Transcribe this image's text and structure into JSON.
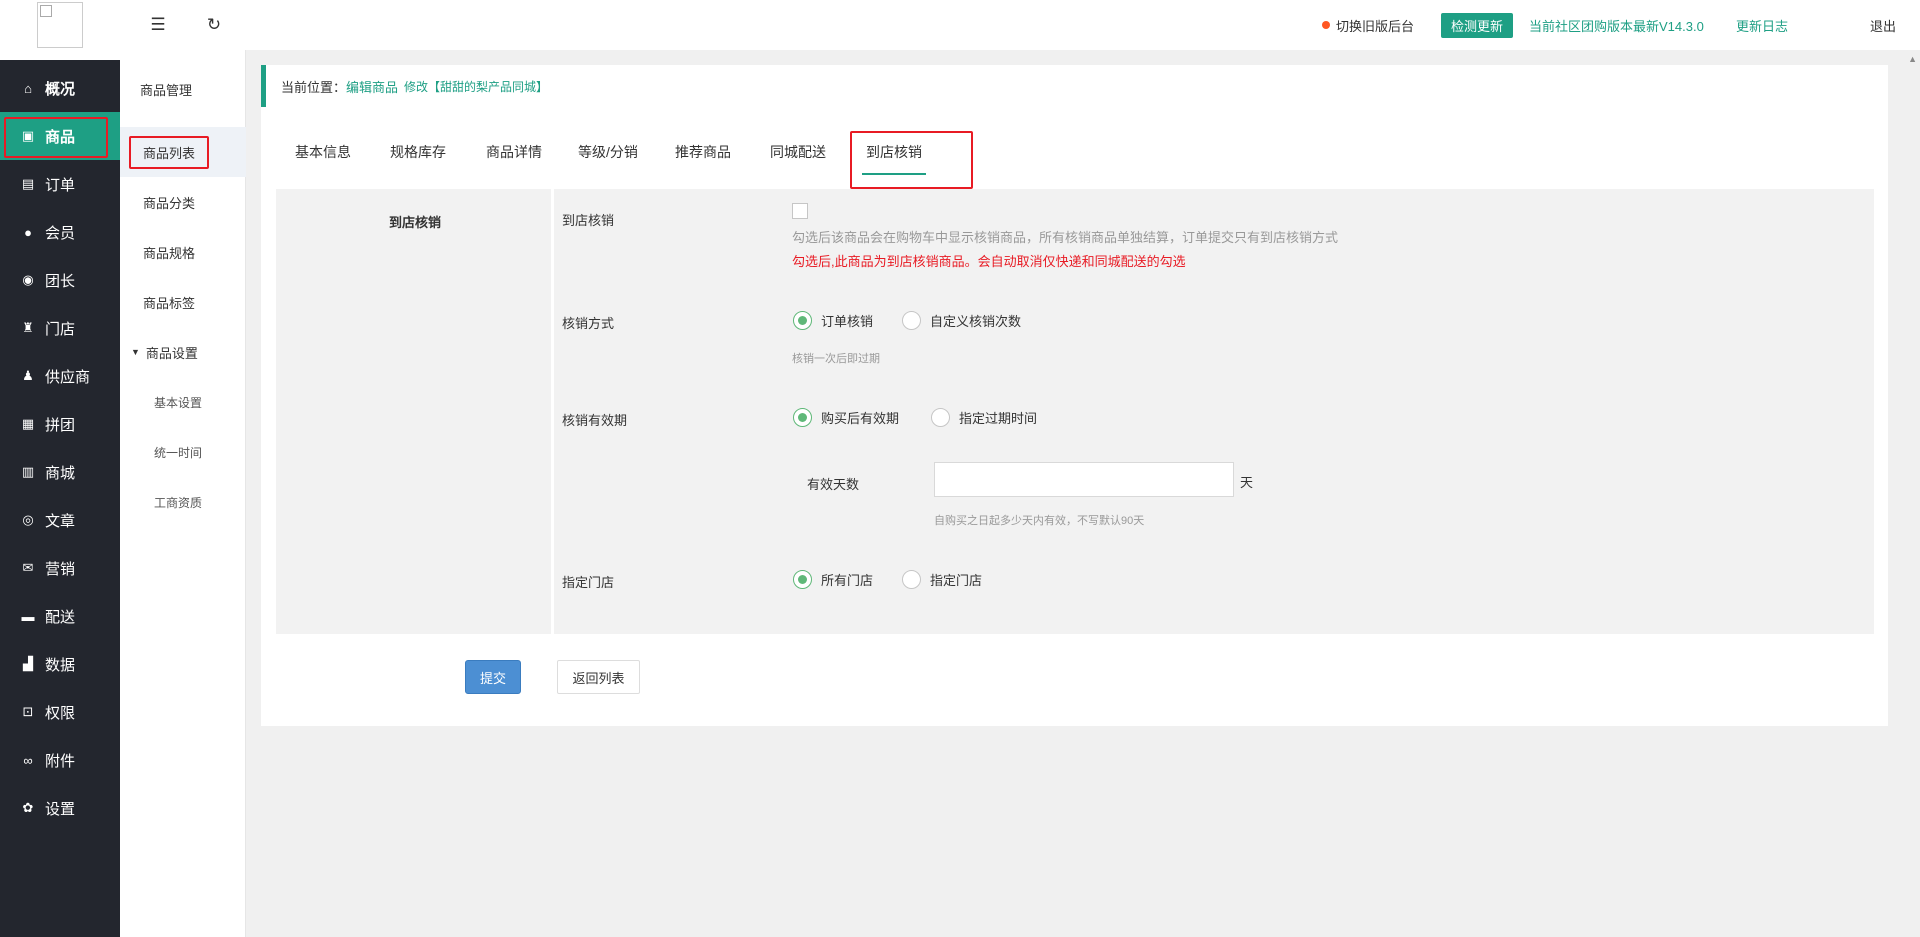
{
  "header": {
    "switch_old": "切换旧版后台",
    "check_update": "检测更新",
    "version_text": "当前社区团购版本最新V14.3.0",
    "changelog": "更新日志",
    "logout": "退出"
  },
  "sidebar": {
    "items": [
      {
        "label": "概况",
        "icon": "home-icon",
        "glyph": "⌂"
      },
      {
        "label": "商品",
        "icon": "product-icon",
        "glyph": "▣"
      },
      {
        "label": "订单",
        "icon": "order-icon",
        "glyph": "▤"
      },
      {
        "label": "会员",
        "icon": "member-icon",
        "glyph": "●"
      },
      {
        "label": "团长",
        "icon": "leader-icon",
        "glyph": "◉"
      },
      {
        "label": "门店",
        "icon": "store-icon",
        "glyph": "♜"
      },
      {
        "label": "供应商",
        "icon": "supplier-icon",
        "glyph": "♟"
      },
      {
        "label": "拼团",
        "icon": "group-buy-icon",
        "glyph": "▦"
      },
      {
        "label": "商城",
        "icon": "mall-icon",
        "glyph": "▥"
      },
      {
        "label": "文章",
        "icon": "article-icon",
        "glyph": "◎"
      },
      {
        "label": "营销",
        "icon": "marketing-icon",
        "glyph": "✉"
      },
      {
        "label": "配送",
        "icon": "delivery-icon",
        "glyph": "▬"
      },
      {
        "label": "数据",
        "icon": "data-icon",
        "glyph": "▟"
      },
      {
        "label": "权限",
        "icon": "lock-icon",
        "glyph": "⊡"
      },
      {
        "label": "附件",
        "icon": "attachment-icon",
        "glyph": "∞"
      },
      {
        "label": "设置",
        "icon": "gear-icon",
        "glyph": "✿"
      }
    ]
  },
  "subnav": {
    "title": "商品管理",
    "list": "商品列表",
    "category": "商品分类",
    "spec": "商品规格",
    "tags": "商品标签",
    "settings_group": "商品设置",
    "basic_settings": "基本设置",
    "unified_time": "统一时间",
    "business_qual": "工商资质"
  },
  "breadcrumb": {
    "lead": "当前位置：",
    "edit": "编辑商品",
    "modify": "修改【甜甜的梨产品同城】"
  },
  "tabs": [
    "基本信息",
    "规格库存",
    "商品详情",
    "等级/分销",
    "推荐商品",
    "同城配送",
    "到店核销"
  ],
  "form": {
    "section_title": "到店核销",
    "verify_label": "到店核销",
    "verify_hint": "勾选后该商品会在购物车中显示核销商品，所有核销商品单独结算，订单提交只有到店核销方式",
    "verify_warn": "勾选后,此商品为到店核销商品。会自动取消仅快递和同城配送的勾选",
    "method_label": "核销方式",
    "method_opt1": "订单核销",
    "method_opt2": "自定义核销次数",
    "method_hint": "核销一次后即过期",
    "validity_label": "核销有效期",
    "validity_opt1": "购买后有效期",
    "validity_opt2": "指定过期时间",
    "days_label": "有效天数",
    "days_value": "",
    "days_unit": "天",
    "days_hint": "自购买之日起多少天内有效，不写默认90天",
    "store_label": "指定门店",
    "store_opt1": "所有门店",
    "store_opt2": "指定门店"
  },
  "buttons": {
    "submit": "提交",
    "back": "返回列表"
  }
}
